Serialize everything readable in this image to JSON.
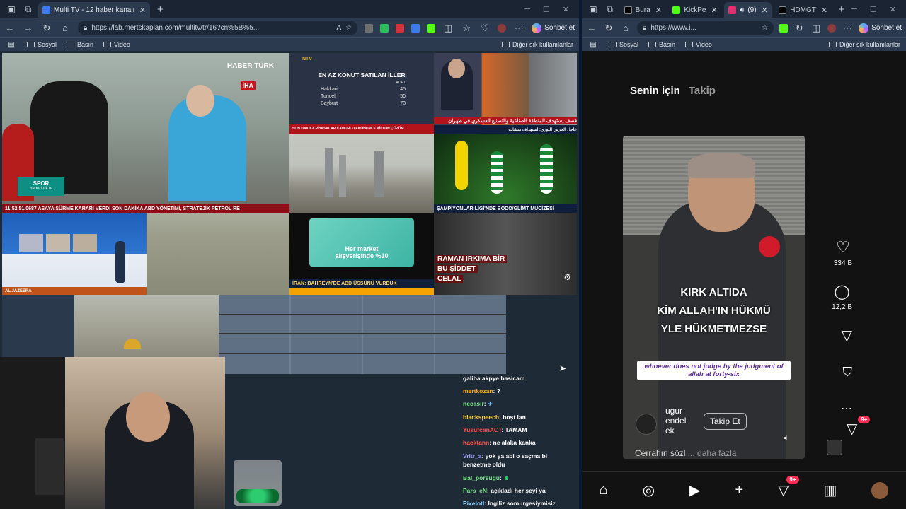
{
  "left_window": {
    "tabs": [
      {
        "title": "Multi TV - 12 haber kanalını aynı a"
      }
    ],
    "url": "https://lab.mertskaplan.com/multitv/tr/16?cn%5B%5...",
    "copilot_label": "Sohbet et",
    "bookmarks": [
      "Sosyal",
      "Basın",
      "Video"
    ],
    "bookmarks_other": "Diğer sık kullanılanlar",
    "channels": {
      "haberturk_logo": "HABER TÜRK",
      "iha": "İHA",
      "spor_label": "SPOR",
      "haberturk_url": "haberturk.tv",
      "ticker_main": "11:52  51.0687   ASAYA SÜRME KARARI VERDİ   SON DAKİKA   ABD YÖNETİMİ, STRATEJİK PETROL RE",
      "ntv_logo": "NTV",
      "table_title": "EN AZ KONUT SATILAN İLLER",
      "table_col": "ADET",
      "table_rows": [
        {
          "city": "Hakkari",
          "count": "45"
        },
        {
          "city": "Tunceli",
          "count": "50"
        },
        {
          "city": "Bayburt",
          "count": "73"
        }
      ],
      "ntv_ticker": "SON DAKİKA  PİYASALAR ÇAMURLU EKONOMİ 5 MİLYON ÇÖZÜM",
      "arabic_ticker": "قصف يستهدف المنطقة الصناعية والتصنيع العسكري في طهران",
      "arabic_ticker_2": "عاجل  الحرس الثوري: استهداف منشآت",
      "spor_ticker": "ŞAMPİYONLAR LİGİ'NDE BODO/GLİMT MUCİZESİ",
      "aljazeera_ticker": "AL JAZEERA",
      "market_ad_line1": "Her market",
      "market_ad_line2": "alışverişinde %10",
      "bahrain_ticker": "İRAN: BAHREYN'DE ABD ÜSSÜNÜ VURDUK",
      "kahraman_line1": "RAMAN IRKIMA BİR",
      "kahraman_line2": "BU ŞİDDET",
      "kahraman_line3": "CELAL"
    },
    "chat": [
      {
        "user": "",
        "text": "galiba akpye basicam",
        "color": "#ffffff"
      },
      {
        "user": "mertkozan",
        "text": "?",
        "color": "#ffb000"
      },
      {
        "user": "necasir",
        "text": "",
        "color": "#7ee08c"
      },
      {
        "user": "blackspeech",
        "text": "hoşt lan",
        "color": "#ffcf40"
      },
      {
        "user": "YusufcanACT",
        "text": "TAMAM",
        "color": "#ff4a4a"
      },
      {
        "user": "hacktann",
        "text": "ne alaka kanka",
        "color": "#ff5a5a"
      },
      {
        "user": "Vritr_a",
        "text": "yok ya abi o saçma bi benzetme oldu",
        "color": "#a3a3ff"
      },
      {
        "user": "Bal_porsugu",
        "text": "",
        "color": "#7ee08c"
      },
      {
        "user": "Pars_eN",
        "text": "açıkladı her şeyi ya",
        "color": "#7ee08c"
      },
      {
        "user": "Pixelotl",
        "text": "Ingiliz somurgesiymisiz",
        "color": "#8fd3ff"
      }
    ]
  },
  "right_window": {
    "tabs": [
      {
        "title": "Bura",
        "fav": "#1d9bf0"
      },
      {
        "title": "KickPe",
        "fav": "#53fc18"
      },
      {
        "title": "(9)",
        "fav": "#e1306c"
      },
      {
        "title": "HDMGT",
        "fav": "#1d9bf0"
      }
    ],
    "url": "https://www.i...",
    "copilot_label": "Sohbet et",
    "bookmarks": [
      "Sosyal",
      "Basın",
      "Video"
    ],
    "bookmarks_other": "Diğer sık kullanılanlar",
    "feed_tabs": {
      "active": "Senin için",
      "inactive": "Takip"
    },
    "caption_lines": [
      "KIRK ALTIDA",
      "KİM ALLAH'IN HÜKMÜ",
      "YLE HÜKMETMEZSE"
    ],
    "caption_highlight": "ALLAH'IN",
    "subtitle": "whoever does not judge by the judgment of allah at forty-six",
    "username": "ugur endel ek",
    "follow_label": "Takip Et",
    "description": "Cerrahın sözl",
    "more_label": "... daha fazla",
    "likes": "334 B",
    "comments": "12,2 B",
    "nav_badge": "9+",
    "side_badge": "9+"
  }
}
